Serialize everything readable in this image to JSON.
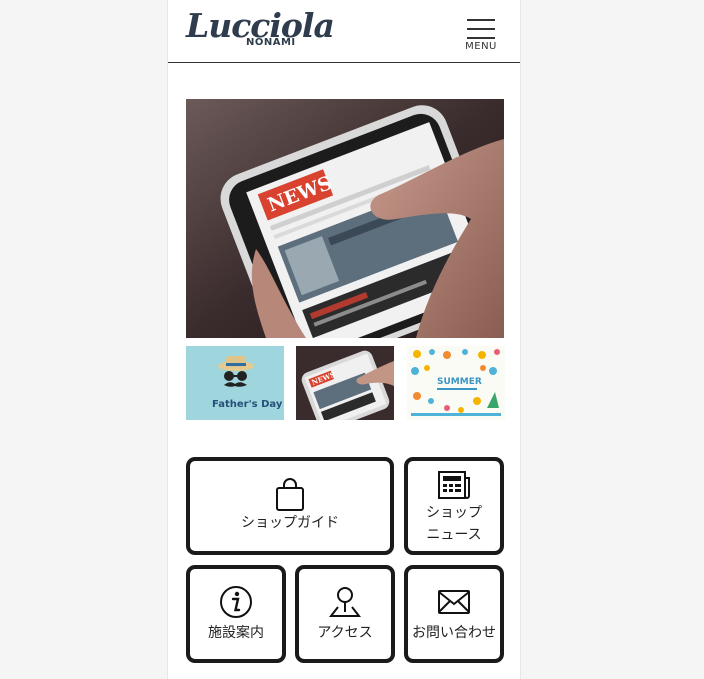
{
  "header": {
    "logo_main": "Lucciola",
    "logo_sub": "NONAMI",
    "menu_label": "MENU"
  },
  "hero": {
    "headline": "NEWS"
  },
  "thumbnails": [
    {
      "name": "father-day",
      "caption": "Father's Day"
    },
    {
      "name": "news-phone",
      "caption": "NEWS"
    },
    {
      "name": "summer",
      "caption": "SUMMER"
    }
  ],
  "tiles": {
    "shop_guide": "ショップガイド",
    "shop_news_line1": "ショップ",
    "shop_news_line2": "ニュース",
    "facility": "施設案内",
    "access": "アクセス",
    "contact": "お問い合わせ"
  },
  "colors": {
    "brand": "#2f3c4d",
    "tile_border": "#1a1a1a",
    "news_red": "#d8422f"
  }
}
